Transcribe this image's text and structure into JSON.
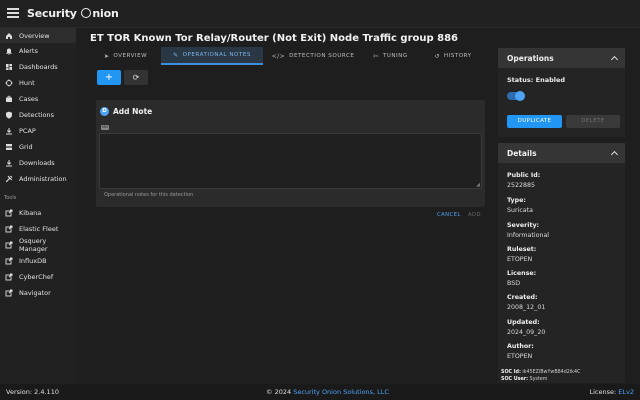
{
  "app": {
    "brand_prefix": "Security",
    "brand_suffix": "nion"
  },
  "sidebar": {
    "items": [
      {
        "label": "Overview",
        "icon": "home-icon"
      },
      {
        "label": "Alerts",
        "icon": "bell-icon"
      },
      {
        "label": "Dashboards",
        "icon": "dashboard-icon"
      },
      {
        "label": "Hunt",
        "icon": "crosshair-icon"
      },
      {
        "label": "Cases",
        "icon": "briefcase-icon"
      },
      {
        "label": "Detections",
        "icon": "shield-icon"
      },
      {
        "label": "PCAP",
        "icon": "download-icon"
      },
      {
        "label": "Grid",
        "icon": "grid-icon"
      },
      {
        "label": "Downloads",
        "icon": "download-icon"
      },
      {
        "label": "Administration",
        "icon": "tools-icon"
      }
    ],
    "tools_label": "Tools",
    "tools": [
      {
        "label": "Kibana"
      },
      {
        "label": "Elastic Fleet"
      },
      {
        "label": "Osquery Manager"
      },
      {
        "label": "InfluxDB"
      },
      {
        "label": "CyberChef"
      },
      {
        "label": "Navigator"
      }
    ]
  },
  "main": {
    "title": "ET TOR Known Tor Relay/Router (Not Exit) Node Traffic group 886",
    "tabs": [
      {
        "label": "OVERVIEW"
      },
      {
        "label": "OPERATIONAL NOTES"
      },
      {
        "label": "DETECTION SOURCE"
      },
      {
        "label": "TUNING"
      },
      {
        "label": "HISTORY"
      }
    ],
    "add_note": {
      "title": "Add Note",
      "badge_letter": "D",
      "markdown_badge": "MD",
      "textarea_value": "",
      "hint": "Operational notes for this detection",
      "cancel_label": "CANCEL",
      "add_label": "ADD"
    }
  },
  "operations": {
    "title": "Operations",
    "status_label": "Status: Enabled",
    "status_enabled": true,
    "duplicate_label": "DUPLICATE",
    "delete_label": "DELETE"
  },
  "details": {
    "title": "Details",
    "fields": [
      {
        "key": "Public Id:",
        "value": "2522885"
      },
      {
        "key": "Type:",
        "value": "Suricata"
      },
      {
        "key": "Severity:",
        "value": "Informational"
      },
      {
        "key": "Ruleset:",
        "value": "ETOPEN"
      },
      {
        "key": "License:",
        "value": "BSD"
      },
      {
        "key": "Created:",
        "value": "2008_12_01"
      },
      {
        "key": "Updated:",
        "value": "2024_09_20"
      },
      {
        "key": "Author:",
        "value": "ETOPEN"
      }
    ],
    "soc_id_label": "SOC Id:",
    "soc_id_value": "ik45EZiBwYwB84d2ik4C",
    "soc_user_label": "SOC User:",
    "soc_user_value": "System"
  },
  "footer": {
    "version": "Version: 2.4.110",
    "copyright_prefix": "© 2024",
    "company": "Security Onion Solutions, LLC",
    "license_prefix": "License:",
    "license_link": "ELv2"
  },
  "colors": {
    "accent": "#2196f3",
    "link": "#4fa3f7",
    "background": "#1e1e1e"
  }
}
